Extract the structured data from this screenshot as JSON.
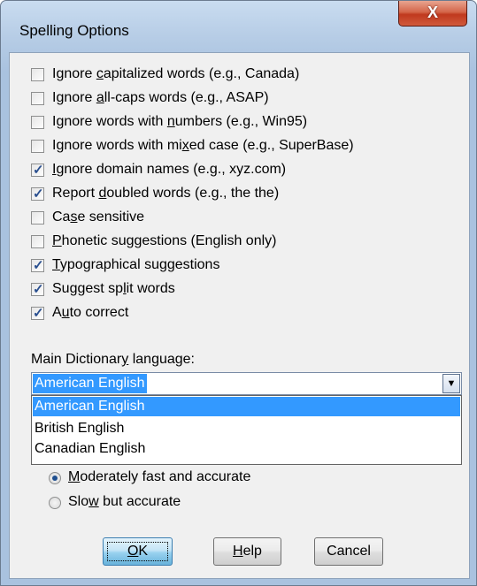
{
  "window": {
    "title": "Spelling Options",
    "close_glyph": "X"
  },
  "options": [
    {
      "pre": "Ignore ",
      "u": "c",
      "post": "apitalized words (e.g., Canada)",
      "checked": false
    },
    {
      "pre": "Ignore ",
      "u": "a",
      "post": "ll-caps words (e.g., ASAP)",
      "checked": false
    },
    {
      "pre": "Ignore words with ",
      "u": "n",
      "post": "umbers (e.g., Win95)",
      "checked": false
    },
    {
      "pre": "Ignore words with mi",
      "u": "x",
      "post": "ed case (e.g., SuperBase)",
      "checked": false
    },
    {
      "pre": "",
      "u": "I",
      "post": "gnore domain names (e.g., xyz.com)",
      "checked": true
    },
    {
      "pre": "Report ",
      "u": "d",
      "post": "oubled words (e.g., the the)",
      "checked": true
    },
    {
      "pre": "Ca",
      "u": "s",
      "post": "e sensitive",
      "checked": false
    },
    {
      "pre": "",
      "u": "P",
      "post": "honetic suggestions (English only)",
      "checked": false
    },
    {
      "pre": "",
      "u": "T",
      "post": "ypographical suggestions",
      "checked": true
    },
    {
      "pre": "Suggest sp",
      "u": "l",
      "post": "it words",
      "checked": true
    },
    {
      "pre": "A",
      "u": "u",
      "post": "to correct",
      "checked": true
    }
  ],
  "language": {
    "label_pre": "Main Dictionar",
    "label_u": "y",
    "label_post": " language:",
    "selected": "American English",
    "options": [
      "American English",
      "British English",
      "Canadian English"
    ]
  },
  "speed": [
    {
      "pre": "",
      "u": "M",
      "post": "oderately fast and accurate",
      "checked": true
    },
    {
      "pre": "Slo",
      "u": "w",
      "post": " but accurate",
      "checked": false
    }
  ],
  "buttons": {
    "ok": {
      "u": "O",
      "post": "K"
    },
    "help": {
      "u": "H",
      "post": "elp"
    },
    "cancel": {
      "label": "Cancel"
    }
  },
  "colors": {
    "accent": "#3399ff",
    "check": "#2a4f8f"
  }
}
